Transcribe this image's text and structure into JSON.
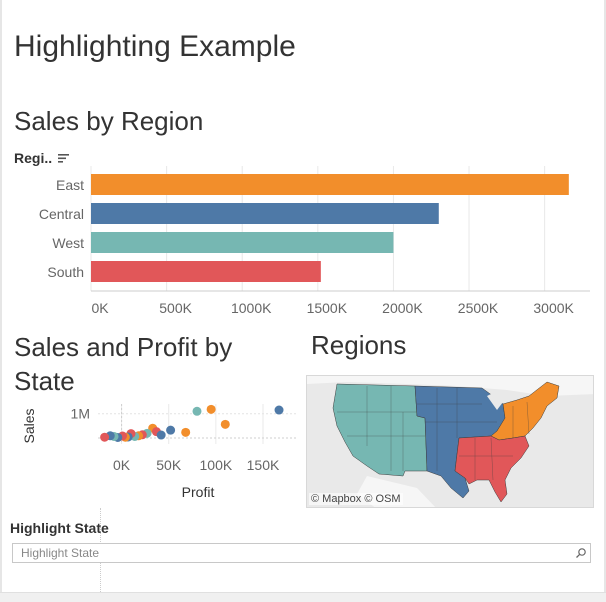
{
  "dashboard": {
    "title": "Highlighting Example"
  },
  "sales_by_region": {
    "title": "Sales by Region",
    "header_label": "Regi..",
    "sort_icon": "sort-descending-icon"
  },
  "sales_profit_by_state": {
    "title": "Sales and Profit by State",
    "ylabel": "Sales",
    "xlabel": "Profit"
  },
  "regions_map": {
    "title": "Regions",
    "attribution": "© Mapbox © OSM",
    "colors": {
      "East": "#f28e2b",
      "Central": "#4e79a7",
      "West": "#76b7b2",
      "South": "#e15759",
      "water": "#e6e6e6",
      "land": "#f4f4f4"
    }
  },
  "highlight_filter": {
    "label": "Highlight State",
    "placeholder": "Highlight State",
    "icon": "search-icon"
  },
  "chart_data": [
    {
      "type": "bar",
      "orientation": "horizontal",
      "title": "Sales by Region",
      "categories": [
        "East",
        "Central",
        "West",
        "South"
      ],
      "values": [
        3160000,
        2300000,
        2000000,
        1520000
      ],
      "colors": [
        "#f28e2b",
        "#4e79a7",
        "#76b7b2",
        "#e15759"
      ],
      "xlim": [
        0,
        3300000
      ],
      "xticks": [
        0,
        500000,
        1000000,
        1500000,
        2000000,
        2500000,
        3000000
      ],
      "xtick_labels": [
        "0K",
        "500K",
        "1000K",
        "1500K",
        "2000K",
        "2500K",
        "3000K"
      ],
      "grid": true
    },
    {
      "type": "scatter",
      "title": "Sales and Profit by State",
      "xlabel": "Profit",
      "ylabel": "Sales",
      "xlim": [
        -25000,
        185000
      ],
      "ylim": [
        -250000,
        1400000
      ],
      "xticks": [
        0,
        50000,
        100000,
        150000
      ],
      "xtick_labels": [
        "0K",
        "50K",
        "100K",
        "150K"
      ],
      "yticks": [
        1000000
      ],
      "ytick_labels": [
        "1M"
      ],
      "grid": true,
      "points": [
        {
          "x": 167000,
          "y": 1150000,
          "region": "Central"
        },
        {
          "x": 95000,
          "y": 1180000,
          "region": "East"
        },
        {
          "x": 80000,
          "y": 1100000,
          "region": "West"
        },
        {
          "x": 110000,
          "y": 560000,
          "region": "East"
        },
        {
          "x": 68000,
          "y": 230000,
          "region": "East"
        },
        {
          "x": 52000,
          "y": 320000,
          "region": "Central"
        },
        {
          "x": 33000,
          "y": 400000,
          "region": "East"
        },
        {
          "x": 37000,
          "y": 260000,
          "region": "South"
        },
        {
          "x": 42000,
          "y": 120000,
          "region": "Central"
        },
        {
          "x": 27000,
          "y": 190000,
          "region": "West"
        },
        {
          "x": 22000,
          "y": 130000,
          "region": "South"
        },
        {
          "x": 18000,
          "y": 90000,
          "region": "East"
        },
        {
          "x": 14000,
          "y": 60000,
          "region": "West"
        },
        {
          "x": 10000,
          "y": 180000,
          "region": "South"
        },
        {
          "x": 7000,
          "y": 40000,
          "region": "Central"
        },
        {
          "x": 4000,
          "y": 30000,
          "region": "East"
        },
        {
          "x": 1000,
          "y": 80000,
          "region": "South"
        },
        {
          "x": -4000,
          "y": 20000,
          "region": "Central"
        },
        {
          "x": -8000,
          "y": 60000,
          "region": "West"
        },
        {
          "x": -12000,
          "y": 90000,
          "region": "Central"
        },
        {
          "x": -18000,
          "y": 30000,
          "region": "South"
        }
      ]
    }
  ]
}
